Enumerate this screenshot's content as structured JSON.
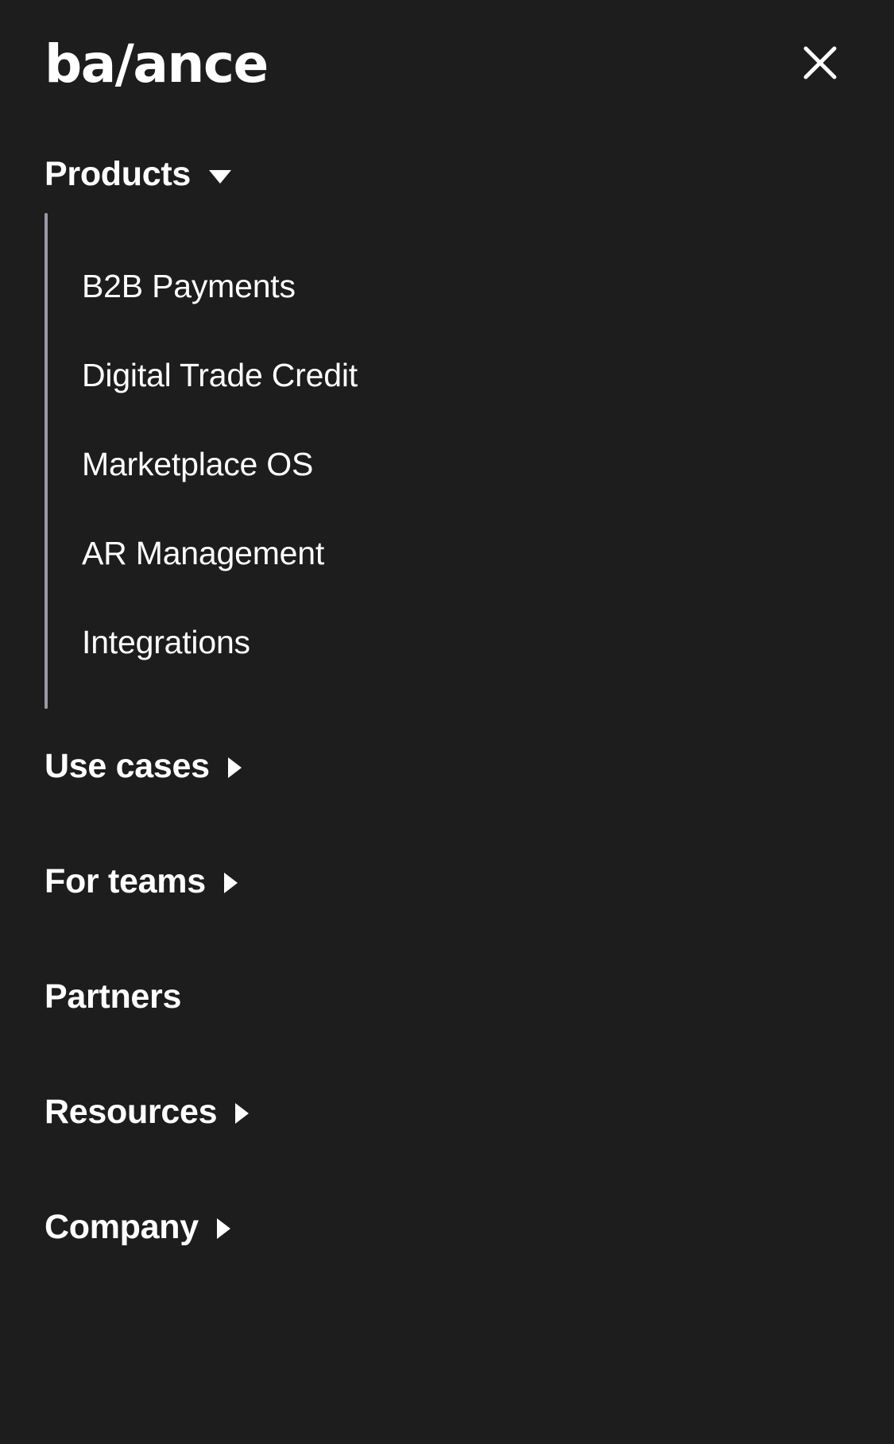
{
  "theme": {
    "background": "#1d1d1d",
    "text": "#ffffff",
    "submenu_rule": "#9a9aa6"
  },
  "header": {
    "logo_text": "ba/ance",
    "close_label": "Close menu",
    "close_icon": "close-icon"
  },
  "menu": {
    "items": [
      {
        "label": "Products",
        "expanded": true,
        "icon": "caret-down-icon",
        "children": [
          {
            "label": "B2B Payments"
          },
          {
            "label": "Digital Trade Credit"
          },
          {
            "label": "Marketplace OS"
          },
          {
            "label": "AR Management"
          },
          {
            "label": "Integrations"
          }
        ]
      },
      {
        "label": "Use cases",
        "expanded": false,
        "icon": "caret-right-icon",
        "children": []
      },
      {
        "label": "For teams",
        "expanded": false,
        "icon": "caret-right-icon",
        "children": []
      },
      {
        "label": "Partners",
        "expanded": false,
        "icon": null,
        "children": []
      },
      {
        "label": "Resources",
        "expanded": false,
        "icon": "caret-right-icon",
        "children": []
      },
      {
        "label": "Company",
        "expanded": false,
        "icon": "caret-right-icon",
        "children": []
      }
    ]
  }
}
